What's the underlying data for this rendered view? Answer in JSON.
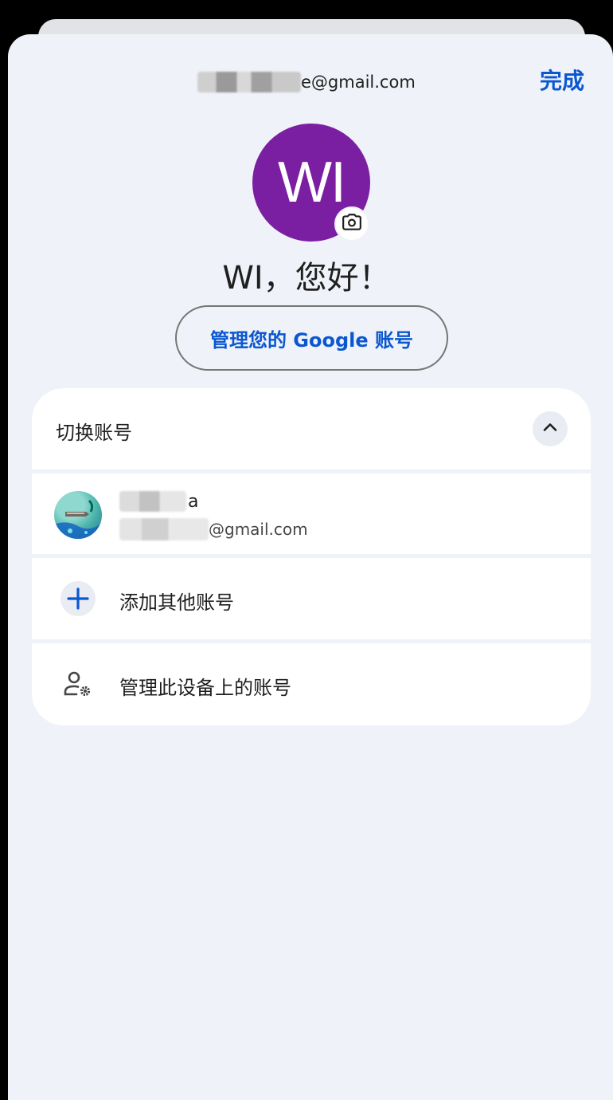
{
  "header": {
    "email_suffix": "e@gmail.com",
    "done_label": "完成"
  },
  "profile": {
    "initials": "WI",
    "avatar_color": "#7b1fa2",
    "greeting": "WI，您好！",
    "manage_account_label": "管理您的 Google 账号"
  },
  "accounts": {
    "section_title": "切换账号",
    "expanded": true,
    "items": [
      {
        "name_suffix": "a",
        "email_suffix": "@gmail.com"
      }
    ],
    "add_account_label": "添加其他账号",
    "manage_device_label": "管理此设备上的账号"
  },
  "colors": {
    "accent": "#0b57d0",
    "sheet_bg": "#eff2f8"
  },
  "icons": {
    "camera": "camera-icon",
    "collapse": "chevron-up-icon",
    "add": "plus-icon",
    "manage": "person-gear-icon"
  }
}
